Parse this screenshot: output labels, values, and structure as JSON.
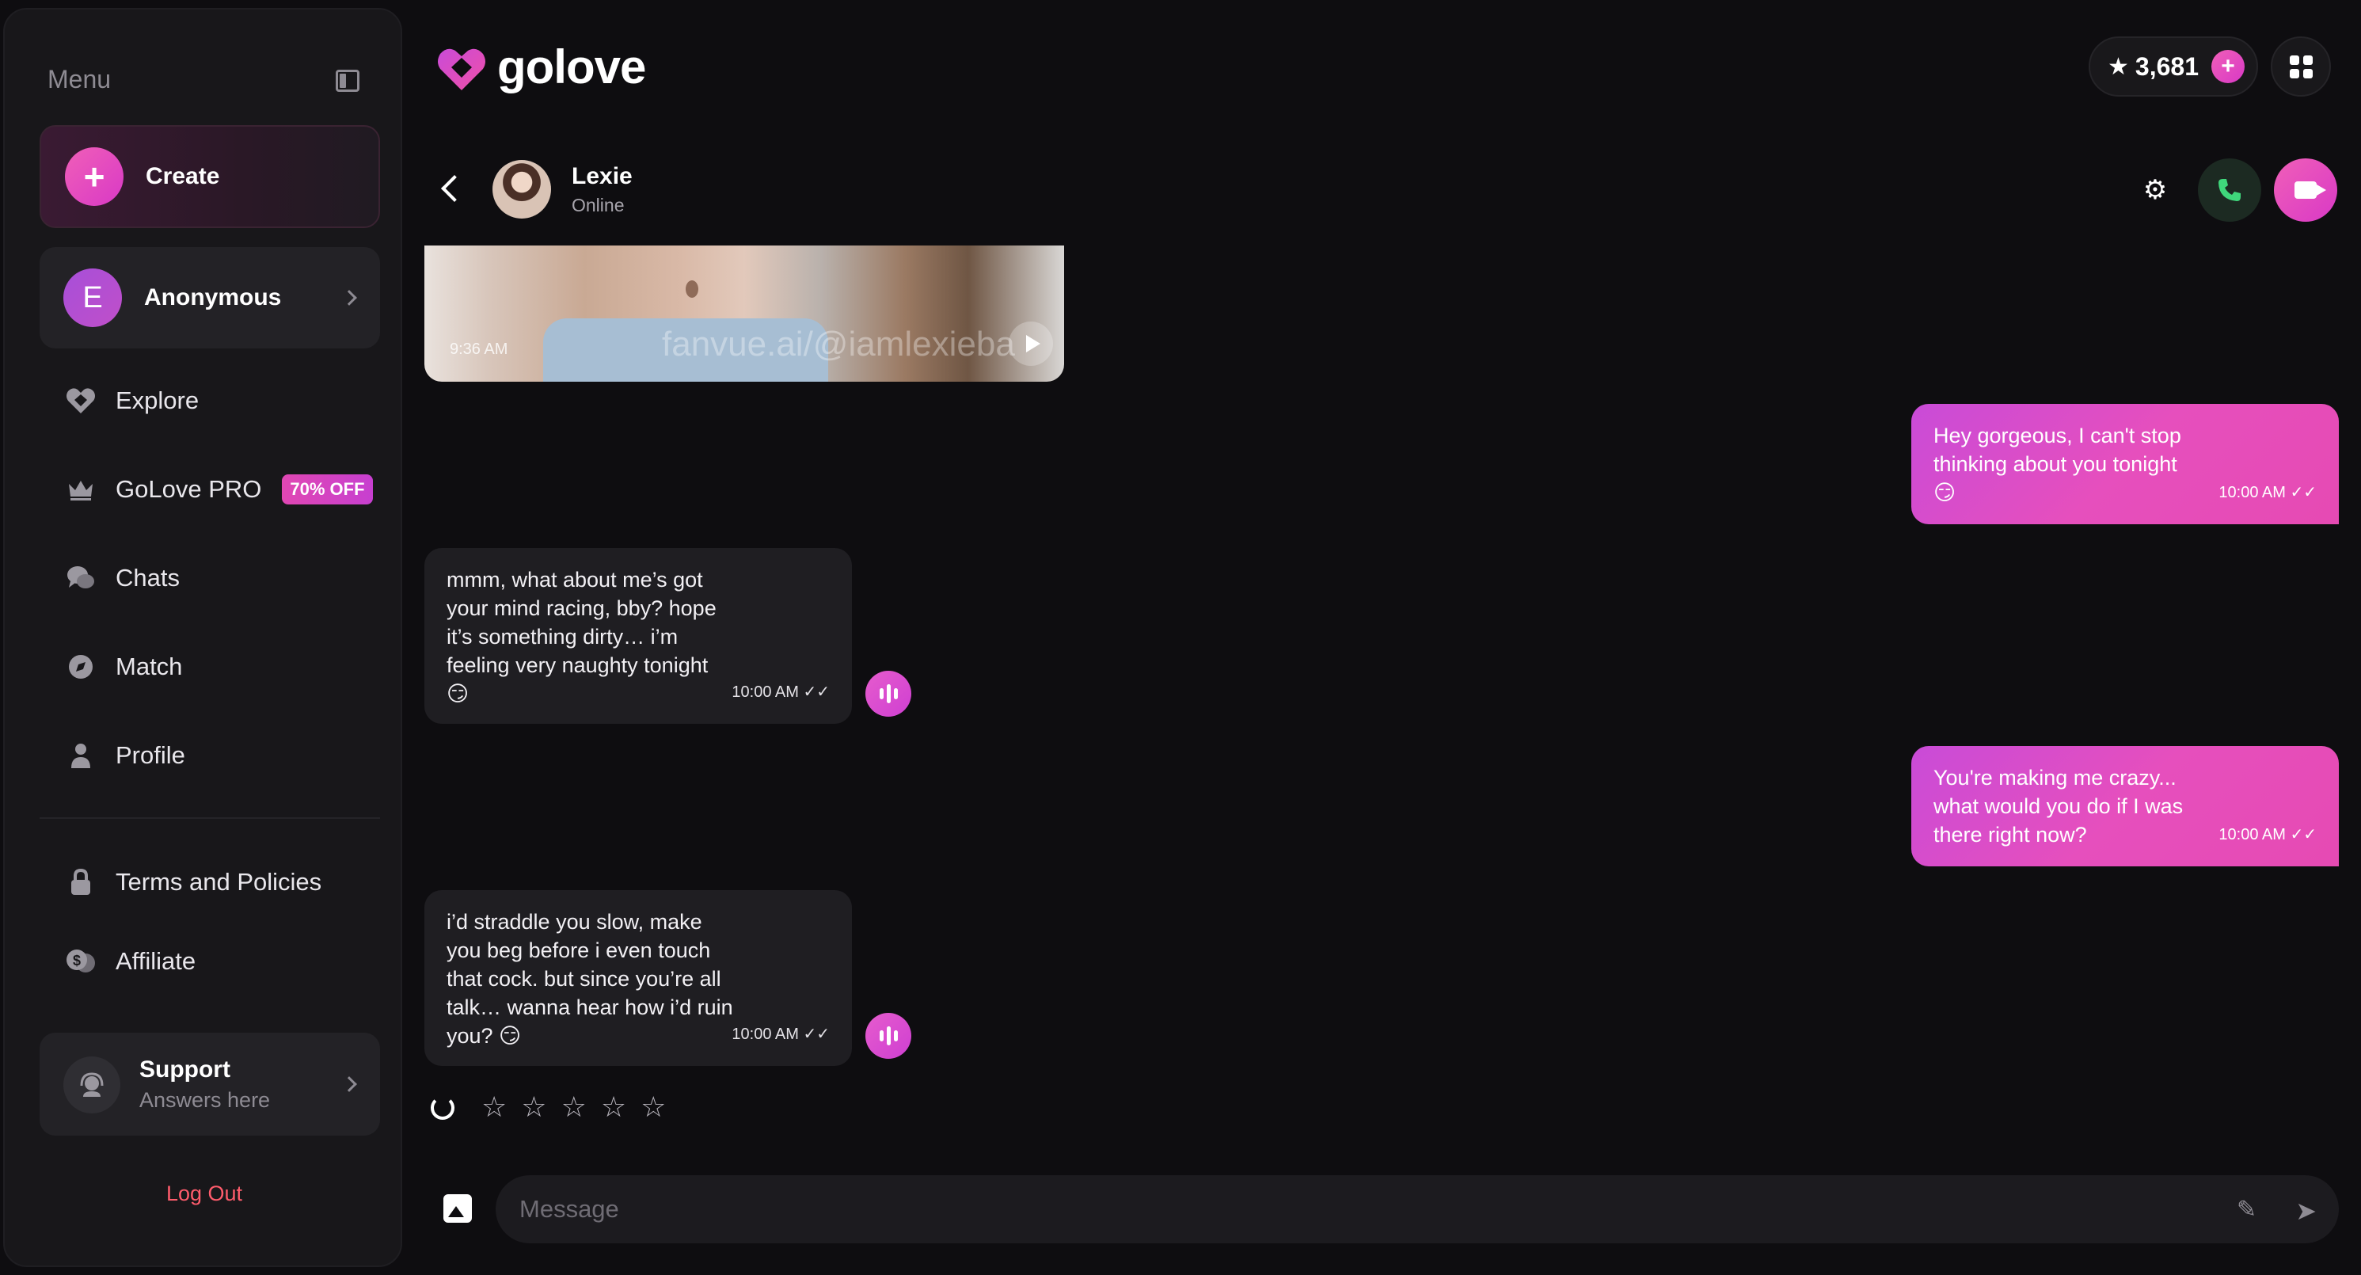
{
  "sidebar": {
    "title": "Menu",
    "create_label": "Create",
    "profile": {
      "initial": "E",
      "name": "Anonymous"
    },
    "nav": [
      {
        "label": "Explore",
        "icon": "golove-heart-icon"
      },
      {
        "label": "GoLove PRO",
        "icon": "crown-icon",
        "badge": "70% OFF"
      },
      {
        "label": "Chats",
        "icon": "chat-bubbles-icon"
      },
      {
        "label": "Match",
        "icon": "compass-icon"
      },
      {
        "label": "Profile",
        "icon": "user-icon"
      },
      {
        "label": "Terms and Policies",
        "icon": "lock-icon"
      },
      {
        "label": "Affiliate",
        "icon": "coins-icon"
      }
    ],
    "support": {
      "title": "Support",
      "subtitle": "Answers here"
    },
    "logout_label": "Log Out"
  },
  "brand": {
    "name": "golove",
    "accent": "#e64fbd",
    "accent2": "#c94bd8"
  },
  "credits": {
    "value": "3,681"
  },
  "chat": {
    "name": "Lexie",
    "status": "Online",
    "media": {
      "time": "9:36 AM",
      "watermark": "fanvue.ai/@iamlexieba"
    },
    "messages": [
      {
        "side": "out",
        "text": "Hey gorgeous, I can't stop thinking about you tonight\n😏",
        "time": "10:00 AM"
      },
      {
        "side": "in",
        "text": "mmm, what about me’s got your mind racing, bby? hope it’s something dirty… i’m feeling very naughty tonight 😏",
        "time": "10:00 AM"
      },
      {
        "side": "out",
        "text": "You're making me crazy... what would you do if I was there right now?",
        "time": "10:00 AM"
      },
      {
        "side": "in",
        "text": "i’d straddle you slow, make you beg before i even touch that cock. but since you’re all talk… wanna hear how i’d ruin you? 😏",
        "time": "10:00 AM"
      }
    ],
    "rating_max": 5
  },
  "composer": {
    "placeholder": "Message"
  }
}
